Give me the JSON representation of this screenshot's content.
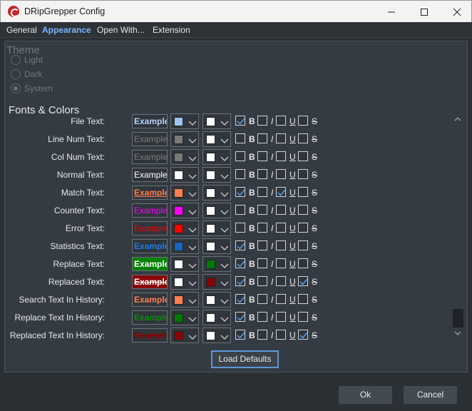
{
  "window": {
    "title": "DRipGrepper Config"
  },
  "menu": [
    {
      "label": "General"
    },
    {
      "label": "Appearance"
    },
    {
      "label": "Open With..."
    },
    {
      "label": "Extension"
    }
  ],
  "theme": {
    "title": "Theme",
    "options": [
      {
        "label": "Light",
        "checked": false
      },
      {
        "label": "Dark",
        "checked": false
      },
      {
        "label": "System",
        "checked": true
      }
    ]
  },
  "fonts": {
    "title": "Fonts & Colors",
    "example_text": "Example",
    "style_letters": [
      "B",
      "I",
      "U",
      "S"
    ],
    "rows": [
      {
        "label": "File Text:",
        "fg": "#9ec4f2",
        "bg": "#ffffff",
        "b": true,
        "i": false,
        "u": false,
        "s": false,
        "ex_color": "#b4d2f5",
        "ex_bg": "#2f353b",
        "ex_bold": true
      },
      {
        "label": "Line Num Text:",
        "fg": "#7a7a7a",
        "bg": "#ffffff",
        "b": false,
        "i": false,
        "u": false,
        "s": false,
        "ex_color": "#7c7c7c",
        "ex_bg": "#2f353b"
      },
      {
        "label": "Col Num Text:",
        "fg": "#7a7a7a",
        "bg": "#ffffff",
        "b": false,
        "i": false,
        "u": false,
        "s": false,
        "ex_color": "#7c7c7c",
        "ex_bg": "#2f353b"
      },
      {
        "label": "Normal Text:",
        "fg": "#ffffff",
        "bg": "#ffffff",
        "b": false,
        "i": false,
        "u": false,
        "s": false,
        "ex_color": "#ffffff",
        "ex_bg": "#2f353b"
      },
      {
        "label": "Match Text:",
        "fg": "#ff7f50",
        "bg": "#ffffff",
        "b": true,
        "i": false,
        "u": true,
        "s": false,
        "ex_color": "#ff7f50",
        "ex_bg": "#2f353b",
        "ex_bold": true,
        "ex_underline": true
      },
      {
        "label": "Counter Text:",
        "fg": "#ff00ff",
        "bg": "#ffffff",
        "b": false,
        "i": false,
        "u": false,
        "s": false,
        "ex_color": "#ff00ff",
        "ex_bg": "#2f353b"
      },
      {
        "label": "Error Text:",
        "fg": "#ff0000",
        "bg": "#ffffff",
        "b": false,
        "i": false,
        "u": false,
        "s": false,
        "ex_color": "#ff0000",
        "ex_bg": "#2f353b"
      },
      {
        "label": "Statistics Text:",
        "fg": "#1565c0",
        "bg": "#ffffff",
        "b": true,
        "i": false,
        "u": false,
        "s": false,
        "ex_color": "#1e7be0",
        "ex_bg": "#2f353b",
        "ex_bold": true
      },
      {
        "label": "Replace Text:",
        "fg": "#ffffff",
        "bg": "#007a00",
        "b": true,
        "i": false,
        "u": false,
        "s": false,
        "ex_color": "#ffffff",
        "ex_bg": "#008000",
        "ex_bold": true
      },
      {
        "label": "Replaced Text:",
        "fg": "#ffffff",
        "bg": "#8b0000",
        "b": true,
        "i": false,
        "u": false,
        "s": true,
        "ex_color": "#ffffff",
        "ex_bg": "#8b0000",
        "ex_bold": true,
        "ex_strike": true
      },
      {
        "label": "Search Text In History:",
        "fg": "#ff7f50",
        "bg": "#ffffff",
        "b": true,
        "i": false,
        "u": false,
        "s": false,
        "ex_color": "#ff7f50",
        "ex_bg": "#2f353b",
        "ex_bold": true
      },
      {
        "label": "Replace Text In History:",
        "fg": "#007a00",
        "bg": "#ffffff",
        "b": true,
        "i": false,
        "u": false,
        "s": false,
        "ex_color": "#0a8a0a",
        "ex_bg": "#2f353b",
        "ex_bold": true
      },
      {
        "label": "Replaced Text In History:",
        "fg": "#8b0000",
        "bg": "#ffffff",
        "b": true,
        "i": false,
        "u": false,
        "s": true,
        "ex_color": "#8b0000",
        "ex_bg": "#2f353b",
        "ex_bold": true,
        "ex_strike": true
      }
    ]
  },
  "buttons": {
    "load_defaults": "Load Defaults",
    "ok": "Ok",
    "cancel": "Cancel"
  }
}
